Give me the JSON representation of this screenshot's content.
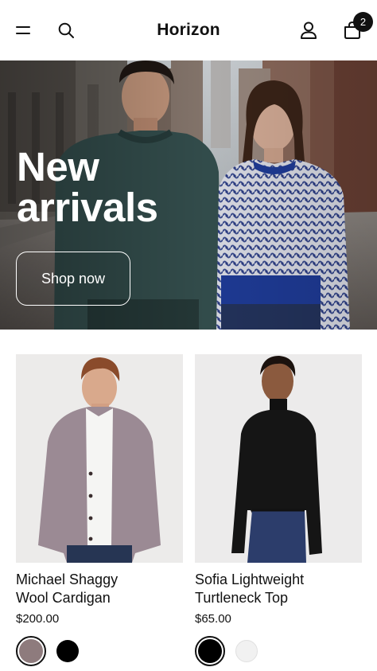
{
  "header": {
    "brand": "Horizon",
    "cart_count": "2",
    "icons": [
      "menu-icon",
      "search-icon",
      "account-icon",
      "cart-icon"
    ]
  },
  "hero": {
    "title_line1": "New",
    "title_line2": "arrivals",
    "cta_label": "Shop now"
  },
  "products": [
    {
      "title_line1": "Michael Shaggy",
      "title_line2": "Wool Cardigan",
      "price": "$200.00",
      "swatches": [
        {
          "color": "#8e7b7d",
          "selected": true
        },
        {
          "color": "#000000",
          "selected": false
        }
      ]
    },
    {
      "title_line1": "Sofia Lightweight",
      "title_line2": "Turtleneck Top",
      "price": "$65.00",
      "swatches": [
        {
          "color": "#000000",
          "selected": true
        },
        {
          "color": "#f1f1f1",
          "selected": false
        }
      ]
    }
  ],
  "colors": {
    "text": "#111111",
    "background": "#ffffff",
    "hero_overlay_text": "#ffffff"
  }
}
